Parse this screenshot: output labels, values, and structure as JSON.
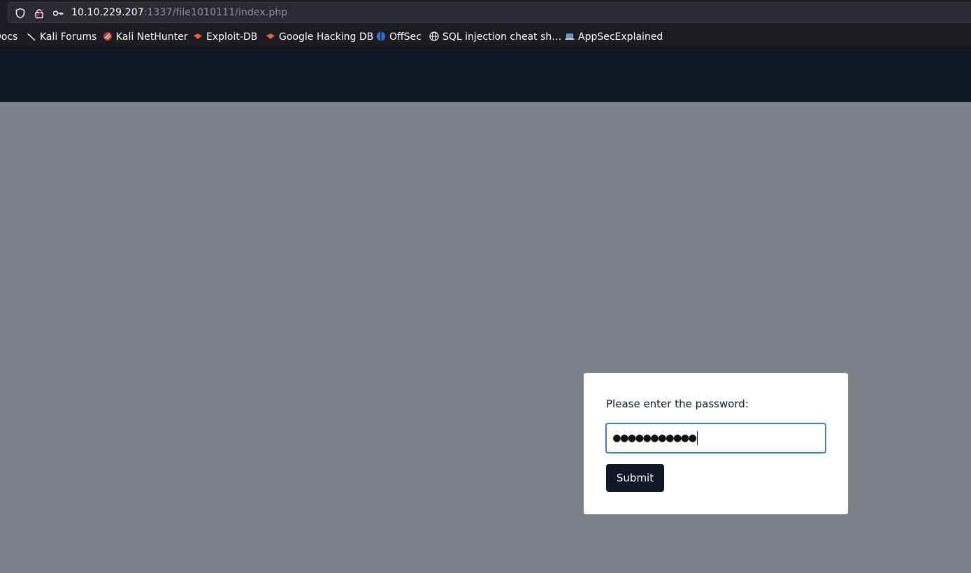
{
  "browser": {
    "url": {
      "host": "10.10.229.207",
      "rest": ":1337/file1010111/index.php"
    },
    "bookmarks": [
      {
        "label": "Docs",
        "icon": "none"
      },
      {
        "label": "Kali Forums",
        "icon": "kali-dragon-icon"
      },
      {
        "label": "Kali NetHunter",
        "icon": "nethunter-icon"
      },
      {
        "label": "Exploit-DB",
        "icon": "exploit-db-icon"
      },
      {
        "label": "Google Hacking DB",
        "icon": "ghdb-icon"
      },
      {
        "label": "OffSec",
        "icon": "offsec-icon"
      },
      {
        "label": "SQL injection cheat sh…",
        "icon": "globe-icon"
      },
      {
        "label": "AppSecExplained",
        "icon": "laptop-icon"
      }
    ]
  },
  "form": {
    "label": "Please enter the password:",
    "password_masked": "●●●●●●●●●●●",
    "submit_label": "Submit"
  },
  "colors": {
    "header_bg": "#111827",
    "page_bg": "#7c818a",
    "button_bg": "#111827",
    "input_focus_border": "#3b82c6"
  }
}
